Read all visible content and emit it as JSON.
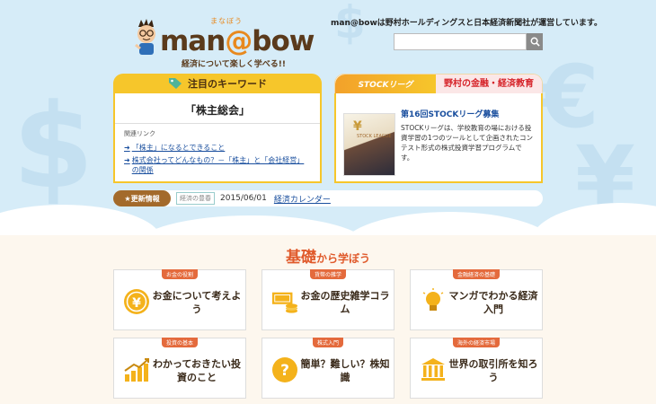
{
  "brand": {
    "ruby": "まなぼう",
    "name_prefix": "man",
    "name_at": "@",
    "name_suffix": "bow",
    "tagline": "経済について楽しく学べる!!"
  },
  "header": {
    "note": "man@bowは野村ホールディングスと日本経済新聞社が運営しています。",
    "search_placeholder": ""
  },
  "keyword": {
    "tab_label": "注目のキーワード",
    "title": "「株主総会」",
    "related_label": "関連リンク",
    "links": [
      "「株主」になるとできること",
      "株式会社ってどんなもの？－「株主」と「会社経営」の関係"
    ]
  },
  "stock_league": {
    "logo_text": "STOCKリーグ",
    "tab_label": "野村の金融・経済教育",
    "photo_title": "STOCK LEAGUE",
    "heading": "第16回STOCKリーグ募集",
    "description": "STOCKリーグは、学校教育の場における投資学習の1つのツールとして企画されたコンテスト形式の株式投資学習プログラムです。"
  },
  "news": {
    "badge": "更新情報",
    "category": "経済の豊春",
    "date": "2015/06/01",
    "link": "経済カレンダー"
  },
  "section": {
    "title_big": "基礎",
    "title_small": "から学ぼう"
  },
  "cards": [
    {
      "tag": "お金の役割",
      "label": "お金について考えよう",
      "icon": "yen-coin-icon"
    },
    {
      "tag": "貨幣の雑学",
      "label": "お金の歴史雑学コラム",
      "icon": "banknote-coins-icon"
    },
    {
      "tag": "金融経済の基礎",
      "label": "マンガでわかる経済入門",
      "icon": "lightbulb-icon"
    },
    {
      "tag": "投資の基本",
      "label": "わかっておきたい投資のこと",
      "icon": "rising-chart-icon"
    },
    {
      "tag": "株式入門",
      "label": "簡単？難しい？株知識",
      "icon": "question-icon"
    },
    {
      "tag": "海外の経済市場",
      "label": "世界の取引所を知ろう",
      "icon": "exchange-building-icon"
    }
  ],
  "colors": {
    "accent": "#f6c62b",
    "brand_brown": "#5a3a1c",
    "orange": "#e8891e",
    "link": "#1a4f9e",
    "section_red": "#e05a2b"
  }
}
